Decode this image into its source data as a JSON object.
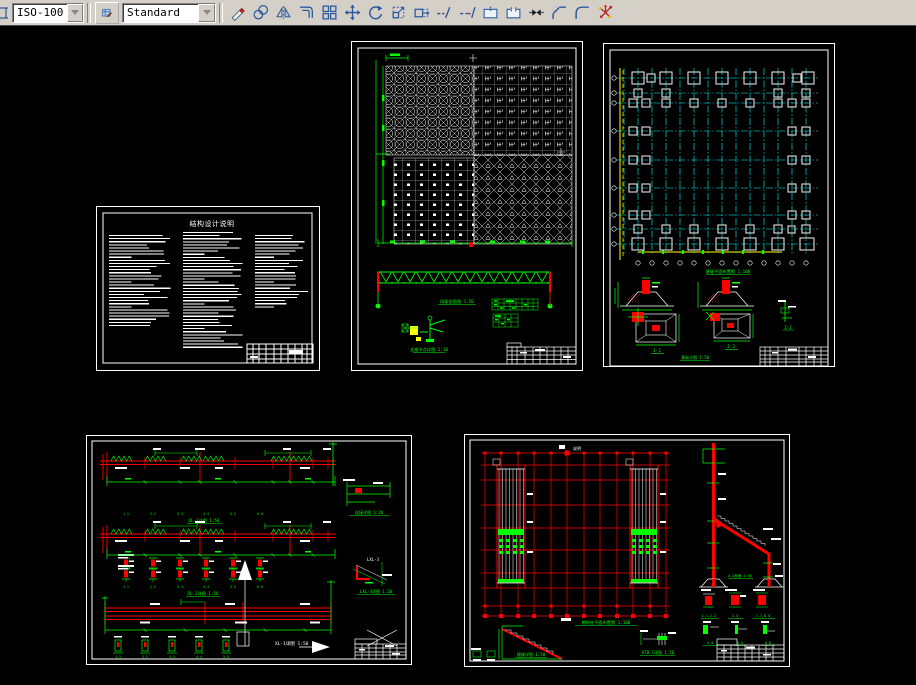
{
  "toolbar": {
    "dim_style_value": "ISO-100",
    "text_style_value": "Standard",
    "icon_names": [
      "erase",
      "copy",
      "mirror",
      "offset",
      "array",
      "move",
      "rotate",
      "scale",
      "stretch",
      "trim",
      "extend",
      "break-at-point",
      "break",
      "join",
      "chamfer",
      "fillet",
      "explode"
    ]
  },
  "colors": {
    "canvas": "#000000",
    "toolbar_bg": "#d4d0c8",
    "icon_blue": "#2a5a9e",
    "green": "#00ff00",
    "red": "#ff0000",
    "cyan": "#00ffff",
    "yellow": "#ffff00",
    "white": "#ffffff"
  },
  "sheets": {
    "notes": {
      "title": "结构设计说明"
    },
    "spaceframe": {
      "truss_label": "网架剖面图 1:50",
      "node_label": "支座节点详图 1:10"
    },
    "foundation": {
      "plan_label": "基础平面布置图 1:100",
      "detail_label": "基础详图 1:50",
      "j1": "J-1",
      "j2": "J-2",
      "z1": "Z-1"
    },
    "beams": {
      "dl1": "DL-1详图 1:50",
      "dl2": "DL-2详图 1:50",
      "xl": "XL-1详图 1:50",
      "joint": "连接详图 1:20",
      "lxl": "LXL-3",
      "lxl_detail": "LXL-3详图 1:20",
      "sections": [
        "1-1",
        "2-2",
        "3-3",
        "4-4",
        "5-5",
        "6-6"
      ]
    },
    "bracing": {
      "top_note": "说明",
      "plan_label": "格构柱平面布置图 1:100",
      "stair_label": "楼梯详图 1:50",
      "ktb_label": "KTB-1详图 1:50",
      "elev_label": "A-A剖面 1:50",
      "sec_labels": [
        "1-1,2-2",
        "3-3",
        "7-7,8-8",
        "4-4",
        "5-5",
        "6-6"
      ]
    }
  }
}
